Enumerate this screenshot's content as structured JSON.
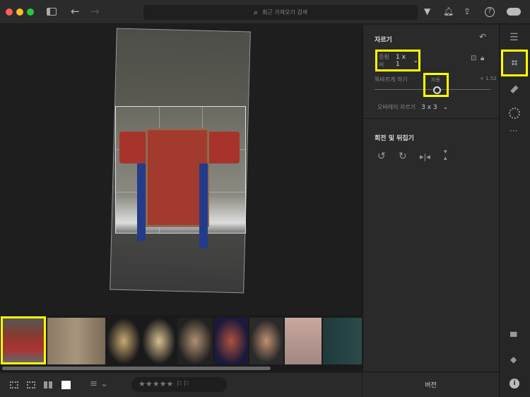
{
  "topbar": {
    "search_placeholder": "최근 가져오기 검색",
    "icons": [
      "sidebar-icon",
      "back-arrow-icon",
      "forward-arrow-icon",
      "search-icon",
      "filter-icon",
      "bell-icon",
      "share-icon",
      "help-icon",
      "cloud-icon"
    ]
  },
  "crop_panel": {
    "title": "자르기",
    "aspect_label": "종횡비",
    "aspect_value": "1 x 1",
    "straighten_label": "똑바르게 하기",
    "auto_label": "자동",
    "straighten_value": "+ 1.52",
    "overlay_label": "오버레이 자르기",
    "overlay_value": "3 x 3",
    "rotate_title": "회전 및 뒤집기"
  },
  "toolstrip": {
    "icons": [
      "edit-sliders-icon",
      "crop-icon",
      "healing-icon",
      "masking-icon",
      "more-icon",
      "comment-icon",
      "tag-icon",
      "info-icon"
    ]
  },
  "bottom": {
    "version_label": "버전",
    "rating_stars": 5
  },
  "colors": {
    "highlight": "#ffff00",
    "background": "#1e1e1e",
    "panel": "#2a2a2a"
  }
}
